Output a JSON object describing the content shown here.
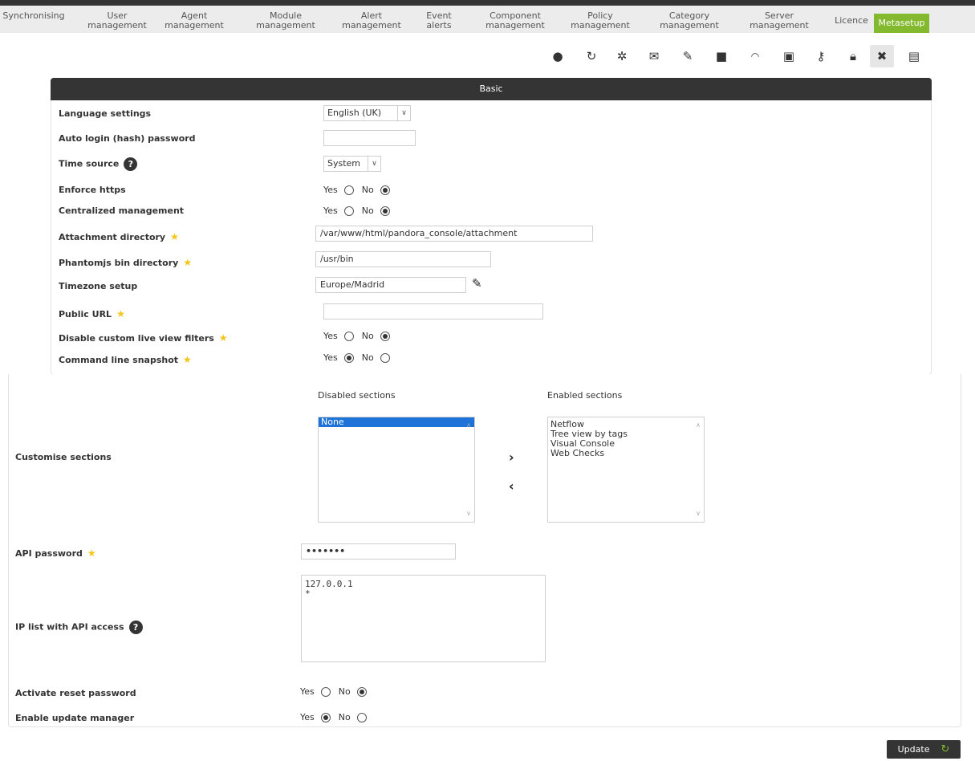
{
  "nav": {
    "items": [
      {
        "label": "Synchronising"
      },
      {
        "label": "User\nmanagement"
      },
      {
        "label": "Agent\nmanagement"
      },
      {
        "label": "Module\nmanagement"
      },
      {
        "label": "Alert\nmanagement"
      },
      {
        "label": "Event\nalerts"
      },
      {
        "label": "Component\nmanagement"
      },
      {
        "label": "Policy\nmanagement"
      },
      {
        "label": "Category\nmanagement"
      },
      {
        "label": "Server\nmanagement"
      },
      {
        "label": "Licence"
      },
      {
        "label": "Metasetup"
      }
    ],
    "active": "Metasetup"
  },
  "toolbar_icons": [
    "map-marker-icon",
    "sync-icon",
    "gear-icon",
    "mail-icon",
    "edit-icon",
    "folder-icon",
    "gauge-icon",
    "chart-icon",
    "key-icon",
    "lock-icon",
    "tools-icon",
    "report-icon"
  ],
  "basic": {
    "header": "Basic",
    "language_label": "Language settings",
    "language_value": "English (UK)",
    "autologin_label": "Auto login (hash) password",
    "autologin_value": "",
    "time_source_label": "Time source",
    "time_source_value": "System",
    "enforce_https_label": "Enforce https",
    "centralized_label": "Centralized management",
    "attachment_label": "Attachment directory",
    "attachment_value": "/var/www/html/pandora_console/attachment",
    "phantomjs_label": "Phantomjs bin directory",
    "phantomjs_value": "/usr/bin",
    "timezone_label": "Timezone setup",
    "timezone_value": "Europe/Madrid",
    "public_url_label": "Public URL",
    "public_url_value": "",
    "disable_filters_label": "Disable custom live view filters",
    "cmd_snapshot_label": "Command line snapshot",
    "yes": "Yes",
    "no": "No"
  },
  "sections": {
    "label": "Customise sections",
    "disabled_title": "Disabled sections",
    "enabled_title": "Enabled sections",
    "disabled_items": [
      "None"
    ],
    "enabled_items": [
      "Netflow",
      "Tree view by tags",
      "Visual Console",
      "Web Checks"
    ]
  },
  "api": {
    "password_label": "API password",
    "password_value": "•••••••",
    "ip_list_label": "IP list with API access",
    "ip_list_value": "127.0.0.1\n*"
  },
  "reset_password_label": "Activate reset password",
  "update_manager_label": "Enable update manager",
  "update_button": "Update"
}
